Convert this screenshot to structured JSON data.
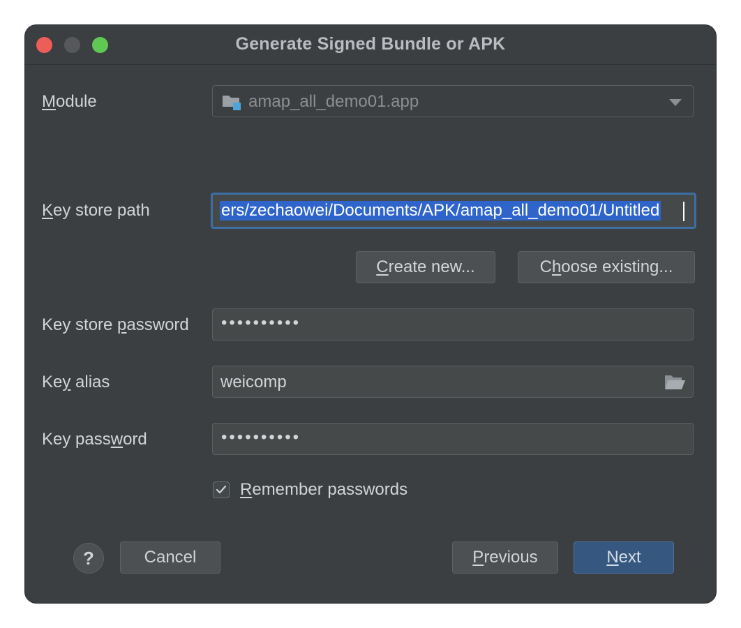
{
  "window": {
    "title": "Generate Signed Bundle or APK"
  },
  "module": {
    "label_prefix": "",
    "label_mnemonic": "M",
    "label_rest": "odule",
    "value": "amap_all_demo01.app"
  },
  "keystore_path": {
    "label_mnemonic": "K",
    "label_rest": "ey store path",
    "value": "ers/zechaowei/Documents/APK/amap_all_demo01/Untitled"
  },
  "buttons": {
    "create_mnemonic": "C",
    "create_rest": "reate new...",
    "choose_prefix": "C",
    "choose_mnemonic": "h",
    "choose_rest": "oose existing...",
    "cancel": "Cancel",
    "previous_mnemonic": "P",
    "previous_rest": "revious",
    "next_mnemonic": "N",
    "next_rest": "ext",
    "help": "?"
  },
  "keystore_password": {
    "label_prefix": "Key store ",
    "label_mnemonic": "p",
    "label_rest": "assword",
    "masked_value": "••••••••••"
  },
  "key_alias": {
    "label_prefix": "Ke",
    "label_mnemonic": "y",
    "label_rest": " alias",
    "value": "weicomp"
  },
  "key_password": {
    "label_prefix": "Key pass",
    "label_mnemonic": "w",
    "label_rest": "ord",
    "masked_value": "••••••••••"
  },
  "remember": {
    "checked": true,
    "label_mnemonic": "R",
    "label_rest": "emember passwords"
  },
  "colors": {
    "window_bg": "#3c3f41",
    "accent_button": "#365880",
    "selection": "#2f65ca",
    "focus_border": "#3d6fa5"
  },
  "icons": {
    "module": "module-folder-icon",
    "dropdown": "chevron-down-icon",
    "alias_browse": "open-folder-icon",
    "checkbox": "checkmark-icon"
  }
}
